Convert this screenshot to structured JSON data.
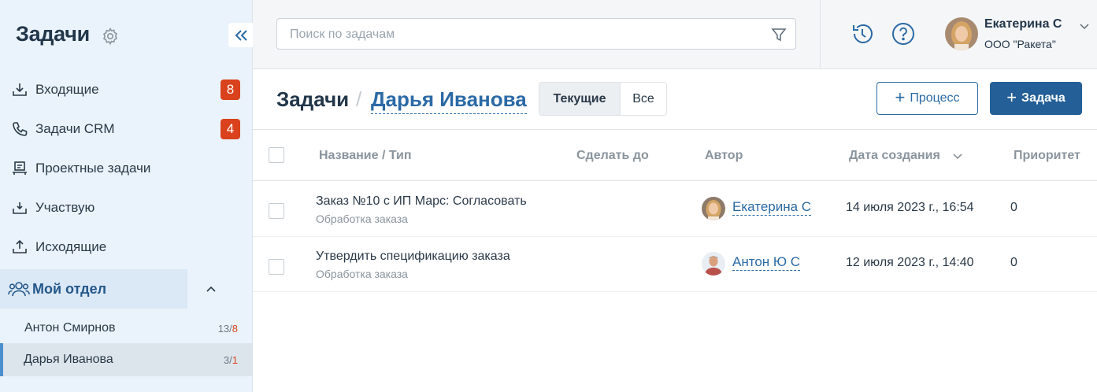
{
  "sidebar": {
    "title": "Задачи",
    "nav": [
      {
        "label": "Входящие",
        "badge": "8"
      },
      {
        "label": "Задачи CRM",
        "badge": "4"
      },
      {
        "label": "Проектные задачи"
      },
      {
        "label": "Участвую"
      },
      {
        "label": "Исходящие"
      }
    ],
    "department": {
      "label": "Мой отдел",
      "members": [
        {
          "name": "Антон Смирнов",
          "total": "13/",
          "overdue": "8"
        },
        {
          "name": "Дарья Иванова",
          "total": "3/",
          "overdue": "1"
        }
      ]
    }
  },
  "topbar": {
    "search_placeholder": "Поиск по задачам",
    "user": {
      "name": "Екатерина С",
      "org": "ООО \"Ракета\""
    }
  },
  "header": {
    "crumb_root": "Задачи",
    "crumb_sep": "/",
    "crumb_current": "Дарья Иванова",
    "tabs": [
      {
        "label": "Текущие",
        "active": true
      },
      {
        "label": "Все",
        "active": false
      }
    ],
    "btn_process": "Процесс",
    "btn_task": "Задача"
  },
  "table": {
    "columns": [
      "Название / Тип",
      "Сделать до",
      "Автор",
      "Дата создания",
      "Приоритет"
    ],
    "rows": [
      {
        "title": "Заказ №10 с ИП Марс: Согласовать",
        "type": "Обработка заказа",
        "deadline": "",
        "author": "Екатерина С",
        "created": "14 июля 2023 г., 16:54",
        "priority": "0"
      },
      {
        "title": "Утвердить спецификацию заказа",
        "type": "Обработка заказа",
        "deadline": "",
        "author": "Антон Ю С",
        "created": "12 июля 2023 г., 14:40",
        "priority": "0"
      }
    ]
  },
  "colors": {
    "accent": "#245f97",
    "link": "#2b6aa5",
    "badge": "#d9421c",
    "sidebar_bg": "#eaf3fb"
  }
}
